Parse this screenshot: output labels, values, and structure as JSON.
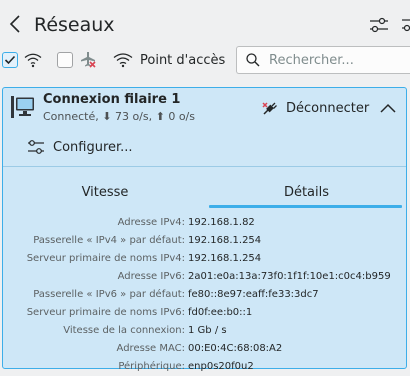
{
  "header": {
    "title": "Réseaux",
    "back_icon": "chevron-left-icon",
    "settings_icon": "configure-icon"
  },
  "toolbar": {
    "wifi_checkbox_checked": true,
    "airplane_checkbox_checked": false,
    "hotspot_label": "Point d'accès",
    "search_placeholder": "Rechercher...",
    "search_value": ""
  },
  "connection": {
    "name": "Connexion filaire 1",
    "status": "Connecté, ⬇ 73 o/s, ⬆ 0 o/s",
    "disconnect_label": "Déconnecter",
    "configure_label": "Configurer...",
    "tabs": [
      {
        "label": "Vitesse",
        "active": false
      },
      {
        "label": "Détails",
        "active": true
      }
    ],
    "details": [
      {
        "label": "Adresse IPv4:",
        "value": "192.168.1.82"
      },
      {
        "label": "Passerelle « IPv4 » par défaut:",
        "value": "192.168.1.254"
      },
      {
        "label": "Serveur primaire de noms IPv4:",
        "value": "192.168.1.254"
      },
      {
        "label": "Adresse IPv6:",
        "value": "2a01:e0a:13a:73f0:1f1f:10e1:c0c4:b959"
      },
      {
        "label": "Passerelle « IPv6 » par défaut:",
        "value": "fe80::8e97:eaff:fe33:3dc7"
      },
      {
        "label": "Serveur primaire de noms IPv6:",
        "value": "fd0f:ee:b0::1"
      },
      {
        "label": "Vitesse de la connexion:",
        "value": "1 Gb / s"
      },
      {
        "label": "Adresse MAC:",
        "value": "00:E0:4C:68:08:A2"
      },
      {
        "label": "Périphérique:",
        "value": "enp0s20f0u2"
      }
    ]
  },
  "colors": {
    "accent": "#3daee9",
    "card_bg": "#cee7f7",
    "window_bg": "#eff0f1",
    "text": "#232627",
    "disconnect_red": "#da4453"
  }
}
